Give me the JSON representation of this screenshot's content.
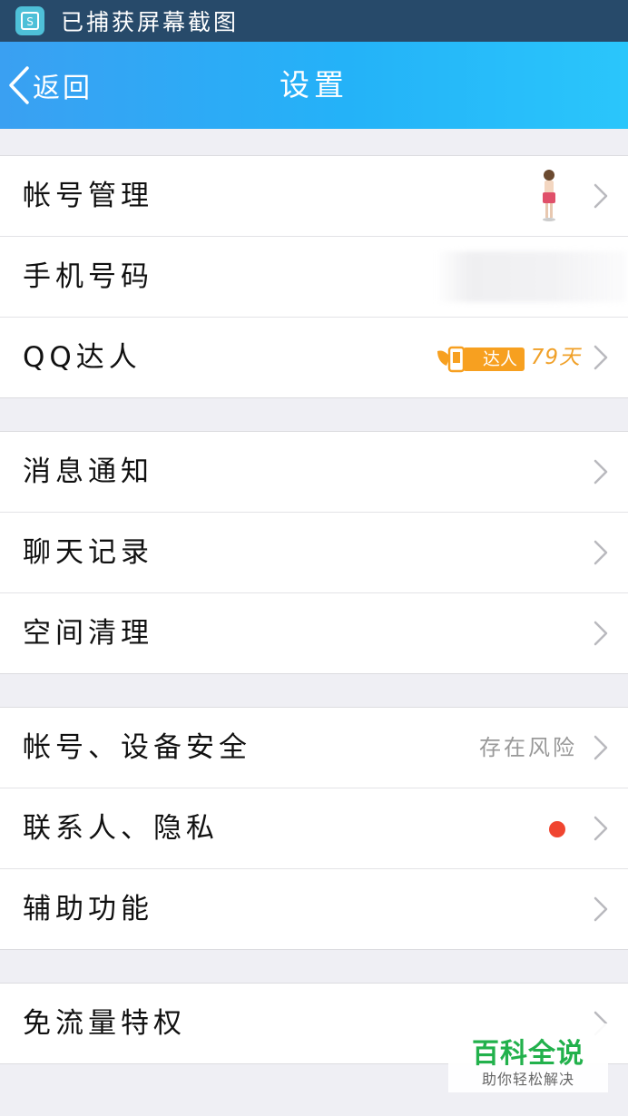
{
  "status_bar": {
    "text": "已捕获屏幕截图",
    "icon": "screenshot-app-icon"
  },
  "nav": {
    "back_label": "返回",
    "title": "设置"
  },
  "groups": [
    {
      "rows": [
        {
          "label": "帐号管理",
          "accessory": "avatar"
        },
        {
          "label": "手机号码",
          "accessory": "blurred-phone"
        },
        {
          "label": "QQ达人",
          "badge": "达人",
          "value": "79天"
        }
      ]
    },
    {
      "rows": [
        {
          "label": "消息通知"
        },
        {
          "label": "聊天记录"
        },
        {
          "label": "空间清理"
        }
      ]
    },
    {
      "rows": [
        {
          "label": "帐号、设备安全",
          "value": "存在风险"
        },
        {
          "label": "联系人、隐私",
          "accessory": "red-dot"
        },
        {
          "label": "辅助功能"
        }
      ]
    },
    {
      "rows": [
        {
          "label": "免流量特权"
        }
      ]
    }
  ],
  "watermark": {
    "main": "百科全说",
    "sub": "助你轻松解决"
  },
  "colors": {
    "nav_start": "#3aa0f2",
    "nav_end": "#2ac6fb",
    "accent_orange": "#f7a020",
    "dot_red": "#f04530",
    "watermark_green": "#22b14c"
  }
}
